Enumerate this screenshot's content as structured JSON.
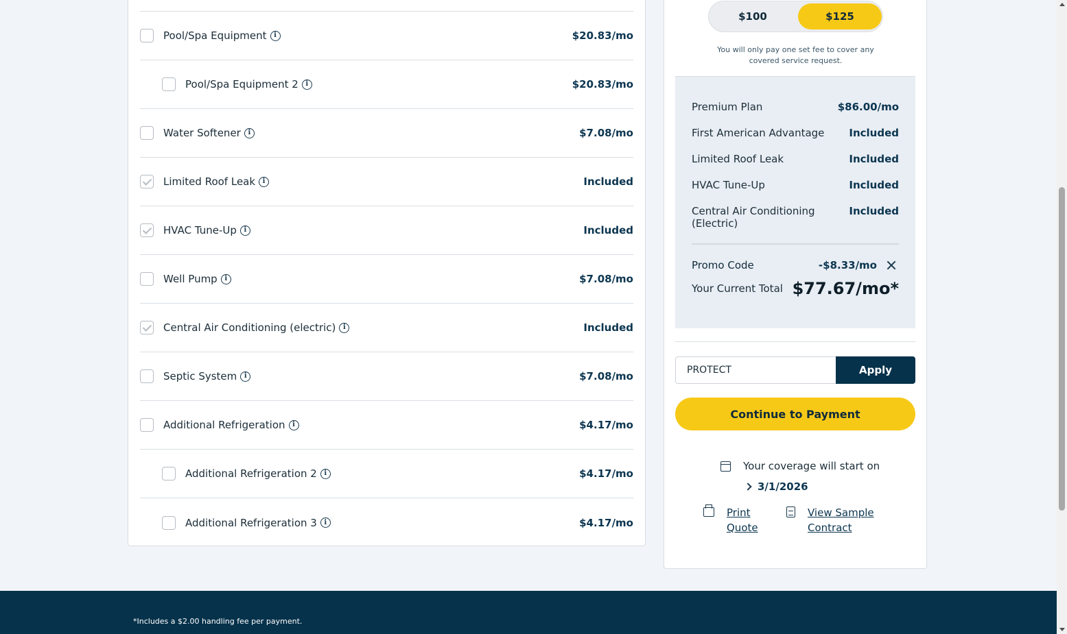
{
  "options": [
    {
      "label": "Pool/Spa Equipment",
      "price": "$20.83/mo",
      "checked": false,
      "sub": false
    },
    {
      "label": "Pool/Spa Equipment 2",
      "price": "$20.83/mo",
      "checked": false,
      "sub": true
    },
    {
      "label": "Water Softener",
      "price": "$7.08/mo",
      "checked": false,
      "sub": false
    },
    {
      "label": "Limited Roof Leak",
      "price": "Included",
      "checked": true,
      "sub": false
    },
    {
      "label": "HVAC Tune-Up",
      "price": "Included",
      "checked": true,
      "sub": false
    },
    {
      "label": "Well Pump",
      "price": "$7.08/mo",
      "checked": false,
      "sub": false
    },
    {
      "label": "Central Air Conditioning (electric)",
      "price": "Included",
      "checked": true,
      "sub": false
    },
    {
      "label": "Septic System",
      "price": "$7.08/mo",
      "checked": false,
      "sub": false
    },
    {
      "label": "Additional Refrigeration",
      "price": "$4.17/mo",
      "checked": false,
      "sub": false
    },
    {
      "label": "Additional Refrigeration 2",
      "price": "$4.17/mo",
      "checked": false,
      "sub": true
    },
    {
      "label": "Additional Refrigeration 3",
      "price": "$4.17/mo",
      "checked": false,
      "sub": true
    }
  ],
  "fee_toggle": {
    "option_a": "$100",
    "option_b": "$125",
    "selected": "$125"
  },
  "fee_note": "You will only pay one set fee to cover any covered service request.",
  "summary": {
    "items": [
      {
        "label": "Premium Plan",
        "value": "$86.00/mo"
      },
      {
        "label": "First American Advantage",
        "value": "Included"
      },
      {
        "label": "Limited Roof Leak",
        "value": "Included"
      },
      {
        "label": "HVAC Tune-Up",
        "value": "Included"
      },
      {
        "label": "Central Air Conditioning (Electric)",
        "value": "Included"
      }
    ],
    "promo_label": "Promo Code",
    "promo_value": "-$8.33/mo",
    "total_label": "Your Current Total",
    "total_value": "$77.67/mo*"
  },
  "promo_input": {
    "value": "PROTECT"
  },
  "apply_label": "Apply",
  "pay_label": "Continue to Payment",
  "coverage_text": "Your coverage will start on",
  "coverage_date": "3/1/2026",
  "print_quote": {
    "line1": "Print",
    "line2": "Quote"
  },
  "view_contract": {
    "line1": "View Sample",
    "line2": "Contract"
  },
  "footer_note": "*Includes a $2.00 handling fee per payment.",
  "colors": {
    "accent": "#f7c917",
    "navy": "#06324b",
    "background": "#f1f4f8"
  }
}
